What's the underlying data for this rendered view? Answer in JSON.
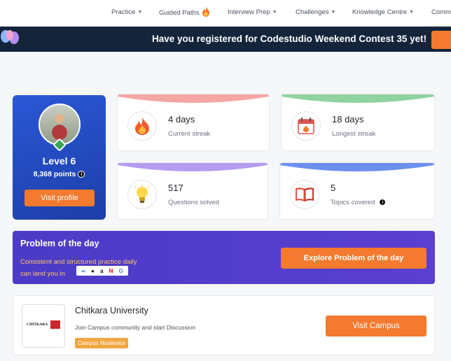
{
  "nav": {
    "items": [
      {
        "label": "Practice"
      },
      {
        "label": "Guided Paths"
      },
      {
        "label": "Interview Prep"
      },
      {
        "label": "Challenges"
      },
      {
        "label": "Knowledge Centre"
      },
      {
        "label": "Comm"
      }
    ]
  },
  "banner": {
    "text": "Have you registered for Codestudio Weekend Contest 35 yet!"
  },
  "profile": {
    "level": "Level 6",
    "points": "8,368 points",
    "visit_label": "Visit profile"
  },
  "stats": [
    {
      "value": "4 days",
      "label": "Current streak",
      "icon": "flame-icon",
      "accent": "#f4a7a3"
    },
    {
      "value": "18 days",
      "label": "Longest streak",
      "icon": "calendar-flame-icon",
      "accent": "#8fd3a0"
    },
    {
      "value": "517",
      "label": "Questions solved",
      "icon": "lightbulb-icon",
      "accent": "#b59cf0"
    },
    {
      "value": "5",
      "label": "Topics covered",
      "icon": "book-icon",
      "accent": "#6d8ff0"
    }
  ],
  "potd": {
    "title": "Problem of the day",
    "subtitle_line1": "Consistent and structured practice daily",
    "subtitle_line2": "can land you in",
    "cta_label": "Explore Problem of the day"
  },
  "campus": {
    "name": "Chitkara University",
    "description": "Join Campus community and start Discussion",
    "badge": "Campus Moderator",
    "cta_label": "Visit Campus",
    "logo_text": "CHITKARA"
  },
  "colors": {
    "accent": "#f37a2e",
    "banner_bg": "#14243b",
    "profile_bg": "#2b58d6",
    "potd_bg": "#4b3bc6"
  }
}
